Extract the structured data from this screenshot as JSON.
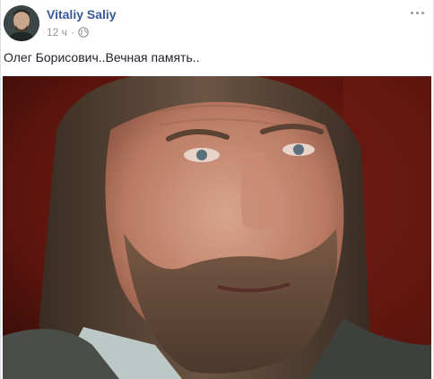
{
  "post": {
    "author": "Vitaliy Saliy",
    "time": "12 ч",
    "separator": "·",
    "text": "Олег Борисович..Вечная память.."
  },
  "icons": {
    "avatar": "avatar",
    "privacy": "globe-icon",
    "menu": "more-options-icon"
  },
  "colors": {
    "author": "#385898",
    "meta": "#90949c",
    "text": "#1d2129"
  }
}
